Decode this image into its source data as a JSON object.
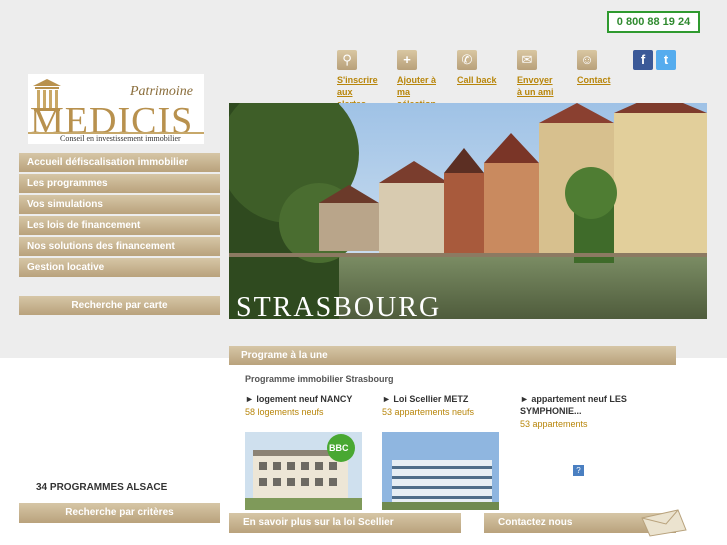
{
  "header": {
    "phone": "0 800 88 19 24",
    "actions": [
      {
        "line1": "S'inscrire",
        "line2": "aux alertes",
        "icon": "location-pin-icon"
      },
      {
        "line1": "Ajouter à",
        "line2": "ma sélection",
        "icon": "plus-icon"
      },
      {
        "line1": "Call back",
        "line2": "",
        "icon": "phone-icon"
      },
      {
        "line1": "Envoyer",
        "line2": "à un ami",
        "icon": "envelope-icon"
      },
      {
        "line1": "Contact",
        "line2": "",
        "icon": "user-icon"
      }
    ],
    "social": [
      "facebook-icon",
      "twitter-icon"
    ]
  },
  "logo": {
    "patrimoine": "Patrimoine",
    "name": "MEDICIS",
    "tagline": "Conseil en investissement immobilier"
  },
  "nav": [
    "Accueil défiscalisation immobilier",
    "Les programmes",
    "Vos simulations",
    "Les lois de financement",
    "Nos solutions des financement",
    "Gestion locative"
  ],
  "map_search": "Recherche par carte",
  "hero": {
    "city": "STRASBOURG"
  },
  "featured": {
    "bar": "Programe à la une",
    "subtitle": "Programme immobilier Strasbourg",
    "programs": [
      {
        "title": "► logement neuf NANCY",
        "count": "58 logements neufs"
      },
      {
        "title": "► Loi Scellier METZ",
        "count": "53 appartements neufs"
      },
      {
        "title": "► appartement  neuf  LES SYMPHONIE...",
        "count": "53 appartements"
      }
    ],
    "badge": "BBC"
  },
  "region_count": "34 PROGRAMMES ALSACE",
  "criteria_search": "Recherche par critères",
  "scellier_link": "En savoir plus sur la loi Scellier",
  "contact_link": "Contactez nous",
  "help_mark": "?",
  "colors": {
    "accent": "#b8860b",
    "button": "#c7b28c",
    "phone_border": "#2f9a2f"
  }
}
